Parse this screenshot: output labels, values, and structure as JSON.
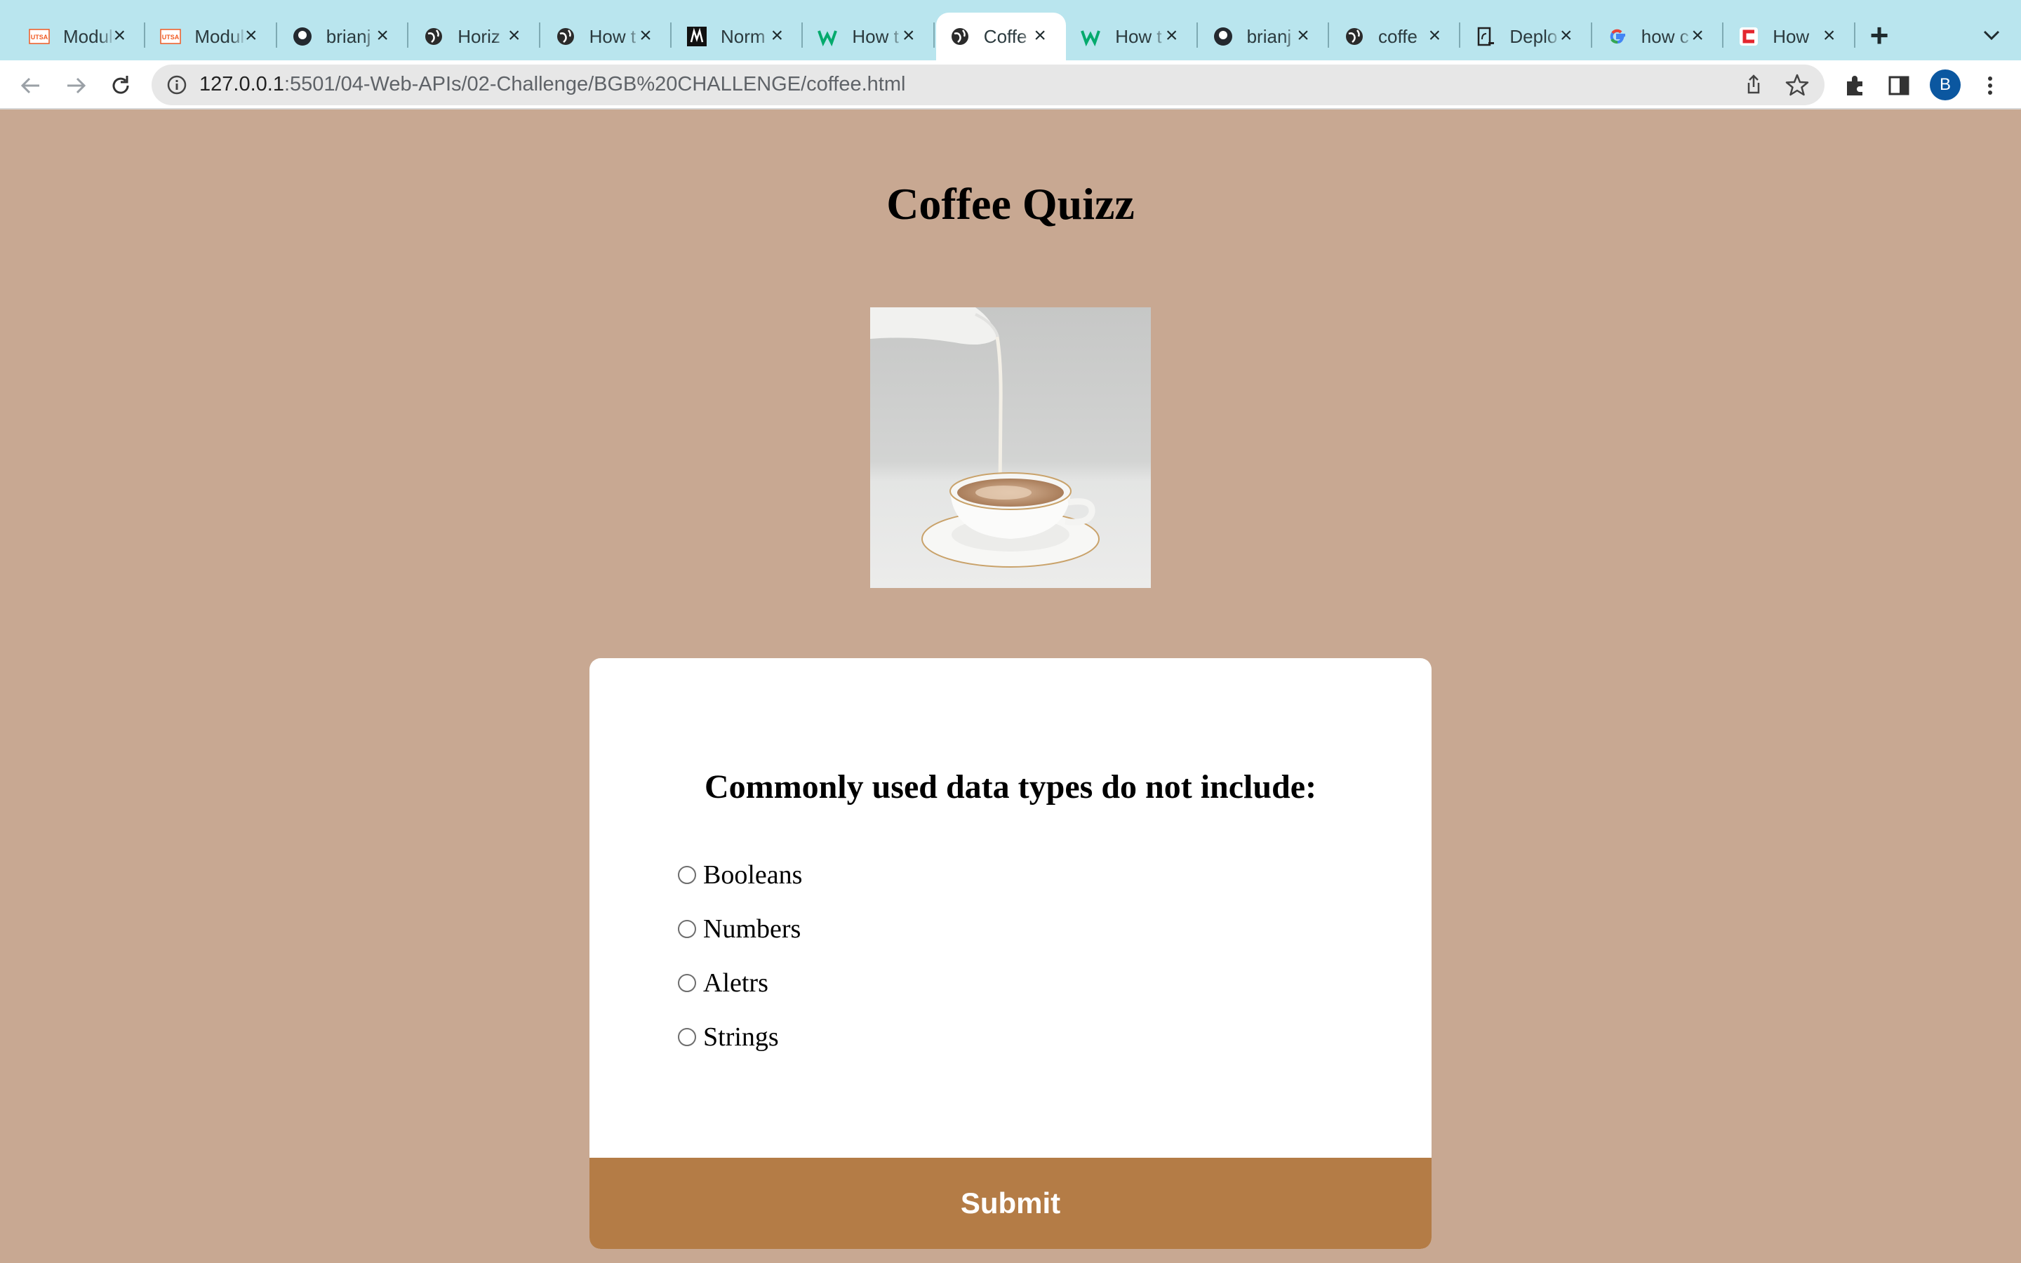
{
  "browser": {
    "tabs": [
      {
        "title": "Module",
        "favicon": "utsa-icon",
        "active": false
      },
      {
        "title": "Module",
        "favicon": "utsa-icon",
        "active": false
      },
      {
        "title": "brianj",
        "favicon": "github-icon",
        "active": false
      },
      {
        "title": "Horiz",
        "favicon": "globe-icon",
        "active": false
      },
      {
        "title": "How t",
        "favicon": "globe-icon",
        "active": false
      },
      {
        "title": "Norm",
        "favicon": "m-logo-icon",
        "active": false
      },
      {
        "title": "How t",
        "favicon": "w3schools-icon",
        "active": false
      },
      {
        "title": "Coffe",
        "favicon": "globe-icon",
        "active": true
      },
      {
        "title": "How t",
        "favicon": "w3schools-icon",
        "active": false
      },
      {
        "title": "brianj",
        "favicon": "github-icon",
        "active": false
      },
      {
        "title": "coffe",
        "favicon": "globe-icon",
        "active": false
      },
      {
        "title": "Deplo",
        "favicon": "deploy-icon",
        "active": false
      },
      {
        "title": "how c",
        "favicon": "google-icon",
        "active": false
      },
      {
        "title": "How",
        "favicon": "red-c-icon",
        "active": false
      }
    ],
    "url_host": "127.0.0.1",
    "url_path": ":5501/04-Web-APIs/02-Challenge/BGB%20CHALLENGE/coffee.html",
    "profile_initial": "B",
    "profile_color": "#0b57a0",
    "tab_strip_color": "#b9e5ee"
  },
  "page": {
    "title": "Coffee Quizz",
    "image": "coffee-cup-milk-pour-image",
    "background": "#c8a892"
  },
  "quiz": {
    "question": "Commonly used data types do not include:",
    "options": [
      "Booleans",
      "Numbers",
      "Aletrs",
      "Strings"
    ],
    "submit_label": "Submit",
    "submit_color": "#b47c46"
  }
}
